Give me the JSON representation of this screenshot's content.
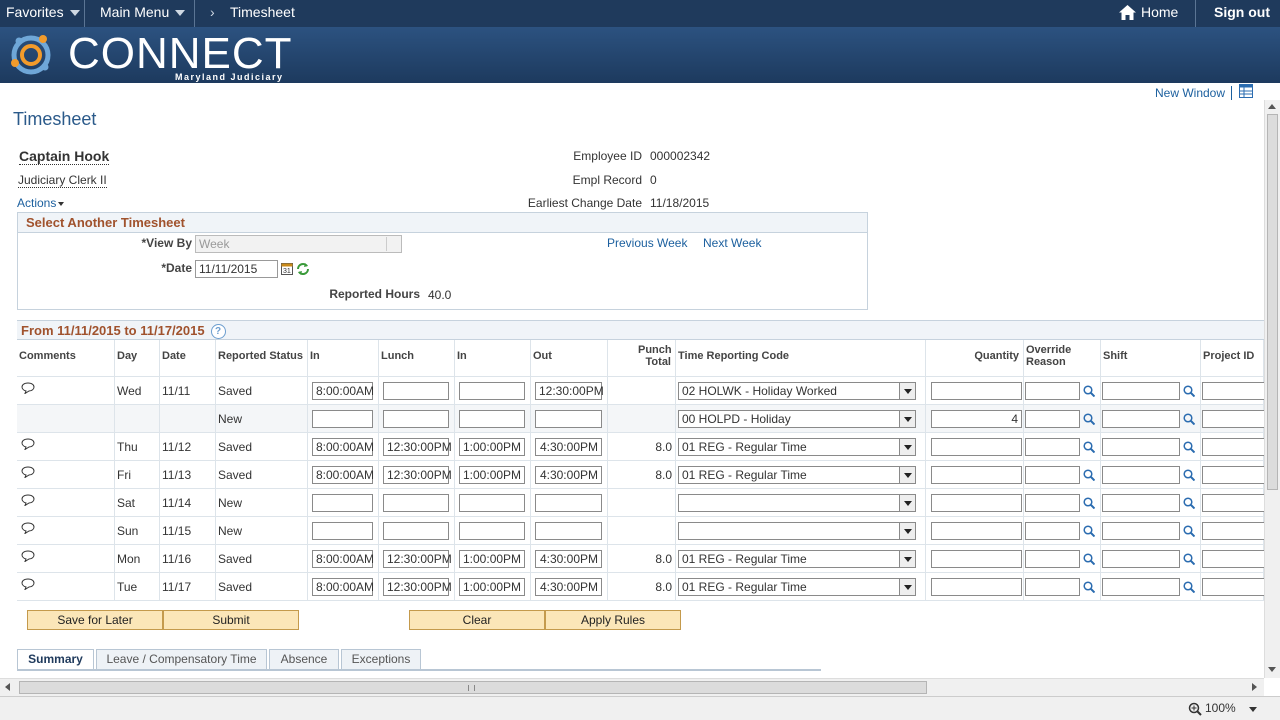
{
  "topbar": {
    "favorites": "Favorites",
    "main_menu": "Main Menu",
    "crumb_sep": "›",
    "breadcrumb": "Timesheet",
    "home": "Home",
    "sign_out": "Sign out"
  },
  "banner": {
    "logo_word": "CONNECT",
    "logo_sub": "Maryland Judiciary"
  },
  "page": {
    "new_window": "New Window",
    "title": "Timesheet",
    "actions": "Actions"
  },
  "employee": {
    "name": "Captain Hook",
    "job": "Judiciary Clerk II",
    "id_label": "Employee ID",
    "id_value": "000002342",
    "rec_label": "Empl Record",
    "rec_value": "0",
    "ecd_label": "Earliest Change Date",
    "ecd_value": "11/18/2015"
  },
  "select": {
    "header": "Select Another Timesheet",
    "view_by_label": "*View By",
    "view_by_value": "Week",
    "date_label": "*Date",
    "date_value": "11/11/2015",
    "prev": "Previous Week",
    "next": "Next Week",
    "reported_label": "Reported Hours",
    "reported_value": "40.0"
  },
  "range": {
    "label": "From 11/11/2015 to 11/17/2015",
    "help": "?"
  },
  "grid": {
    "headers": [
      "Comments",
      "Day",
      "Date",
      "Reported Status",
      "In",
      "Lunch",
      "In",
      "Out",
      "Punch Total",
      "Time Reporting Code",
      "Quantity",
      "Override Reason",
      "Shift",
      "Project ID"
    ],
    "rows": [
      {
        "day": "Wed",
        "date": "11/11",
        "status": "Saved",
        "in1": "8:00:00AM",
        "lunch": "",
        "in2": "",
        "out": "12:30:00PM",
        "total": "",
        "trc": "02 HOLWK - Holiday Worked",
        "qty": "",
        "comment": true
      },
      {
        "day": "",
        "date": "",
        "status": "New",
        "in1": "",
        "lunch": "",
        "in2": "",
        "out": "",
        "total": "",
        "trc": "00 HOLPD - Holiday",
        "qty": "4",
        "comment": false
      },
      {
        "day": "Thu",
        "date": "11/12",
        "status": "Saved",
        "in1": "8:00:00AM",
        "lunch": "12:30:00PM",
        "in2": "1:00:00PM",
        "out": "4:30:00PM",
        "total": "8.0",
        "trc": "01 REG - Regular Time",
        "qty": "",
        "comment": true
      },
      {
        "day": "Fri",
        "date": "11/13",
        "status": "Saved",
        "in1": "8:00:00AM",
        "lunch": "12:30:00PM",
        "in2": "1:00:00PM",
        "out": "4:30:00PM",
        "total": "8.0",
        "trc": "01 REG - Regular Time",
        "qty": "",
        "comment": true
      },
      {
        "day": "Sat",
        "date": "11/14",
        "status": "New",
        "in1": "",
        "lunch": "",
        "in2": "",
        "out": "",
        "total": "",
        "trc": "",
        "qty": "",
        "comment": true
      },
      {
        "day": "Sun",
        "date": "11/15",
        "status": "New",
        "in1": "",
        "lunch": "",
        "in2": "",
        "out": "",
        "total": "",
        "trc": "",
        "qty": "",
        "comment": true
      },
      {
        "day": "Mon",
        "date": "11/16",
        "status": "Saved",
        "in1": "8:00:00AM",
        "lunch": "12:30:00PM",
        "in2": "1:00:00PM",
        "out": "4:30:00PM",
        "total": "8.0",
        "trc": "01 REG - Regular Time",
        "qty": "",
        "comment": true
      },
      {
        "day": "Tue",
        "date": "11/17",
        "status": "Saved",
        "in1": "8:00:00AM",
        "lunch": "12:30:00PM",
        "in2": "1:00:00PM",
        "out": "4:30:00PM",
        "total": "8.0",
        "trc": "01 REG - Regular Time",
        "qty": "",
        "comment": true
      }
    ]
  },
  "buttons": {
    "save_later": "Save for Later",
    "submit": "Submit",
    "clear": "Clear",
    "apply_rules": "Apply Rules"
  },
  "tabs": [
    "Summary",
    "Leave / Compensatory Time",
    "Absence",
    "Exceptions"
  ],
  "statusbar": {
    "zoom": "100%"
  },
  "colors": {
    "topbar": "#1f3a5c",
    "section_title": "#a0522d",
    "link": "#1b5f9e",
    "button": "#fbe6b8"
  }
}
